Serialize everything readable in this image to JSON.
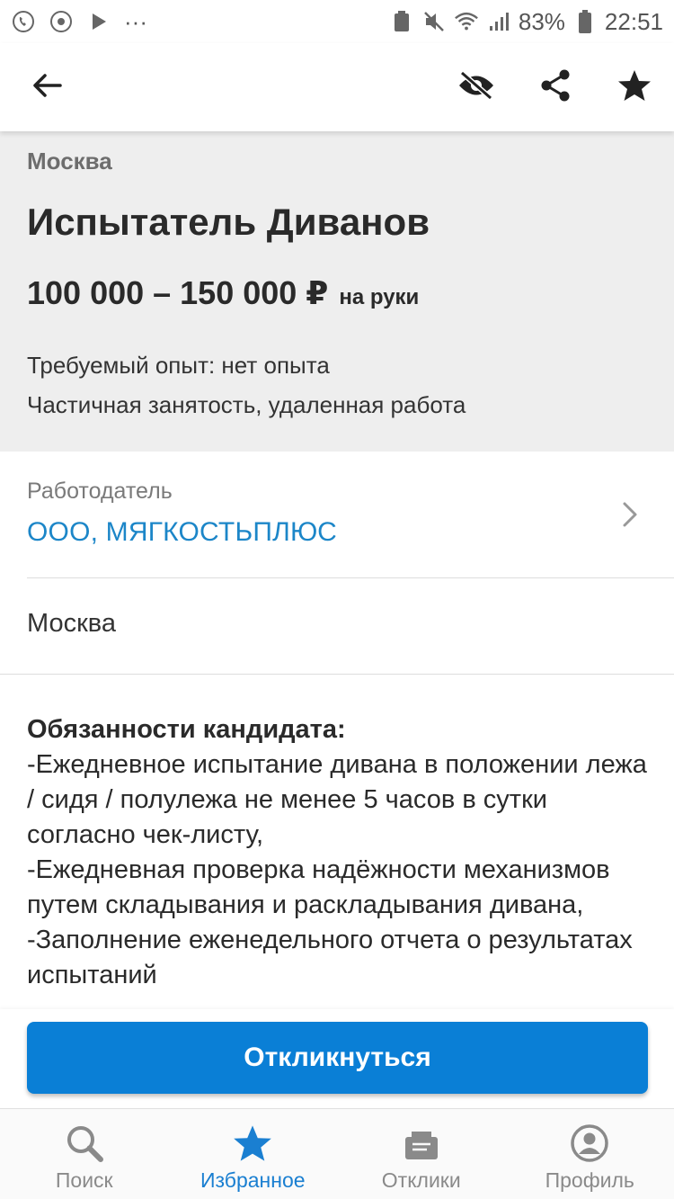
{
  "status_bar": {
    "battery": "83%",
    "time": "22:51",
    "more": "···"
  },
  "toolbar": {
    "back_icon": "arrow-left-icon",
    "hide_icon": "eye-off-icon",
    "share_icon": "share-icon",
    "favorite_icon": "star-icon"
  },
  "vacancy": {
    "city": "Москва",
    "title": "Испытатель Диванов",
    "salary": "100 000 – 150 000 ₽",
    "salary_note": "на руки",
    "experience": "Требуемый опыт: нет опыта",
    "employment": "Частичная занятость, удаленная работа"
  },
  "employer": {
    "label": "Работодатель",
    "name": "ООО, МЯГКОСТЬПЛЮС"
  },
  "location": {
    "city": "Москва"
  },
  "description": {
    "heading": "Обязанности кандидата:",
    "lines": [
      "-Ежедневное испытание дивана в положении лежа / сидя / полулежа не менее 5 часов в сутки согласно чек-листу,",
      "-Ежедневная проверка надёжности механизмов путем складывания и раскладывания дивана,",
      "-Заполнение еженедельного отчета о результатах испытаний"
    ]
  },
  "apply_button": "Откликнуться",
  "nav": {
    "items": [
      {
        "label": "Поиск",
        "icon": "search-icon"
      },
      {
        "label": "Избранное",
        "icon": "star-icon"
      },
      {
        "label": "Отклики",
        "icon": "responses-icon"
      },
      {
        "label": "Профиль",
        "icon": "profile-icon"
      }
    ],
    "active_index": 1
  },
  "colors": {
    "accent": "#0a7fd6",
    "link": "#1c86c8",
    "header_bg": "#eeeeee"
  }
}
